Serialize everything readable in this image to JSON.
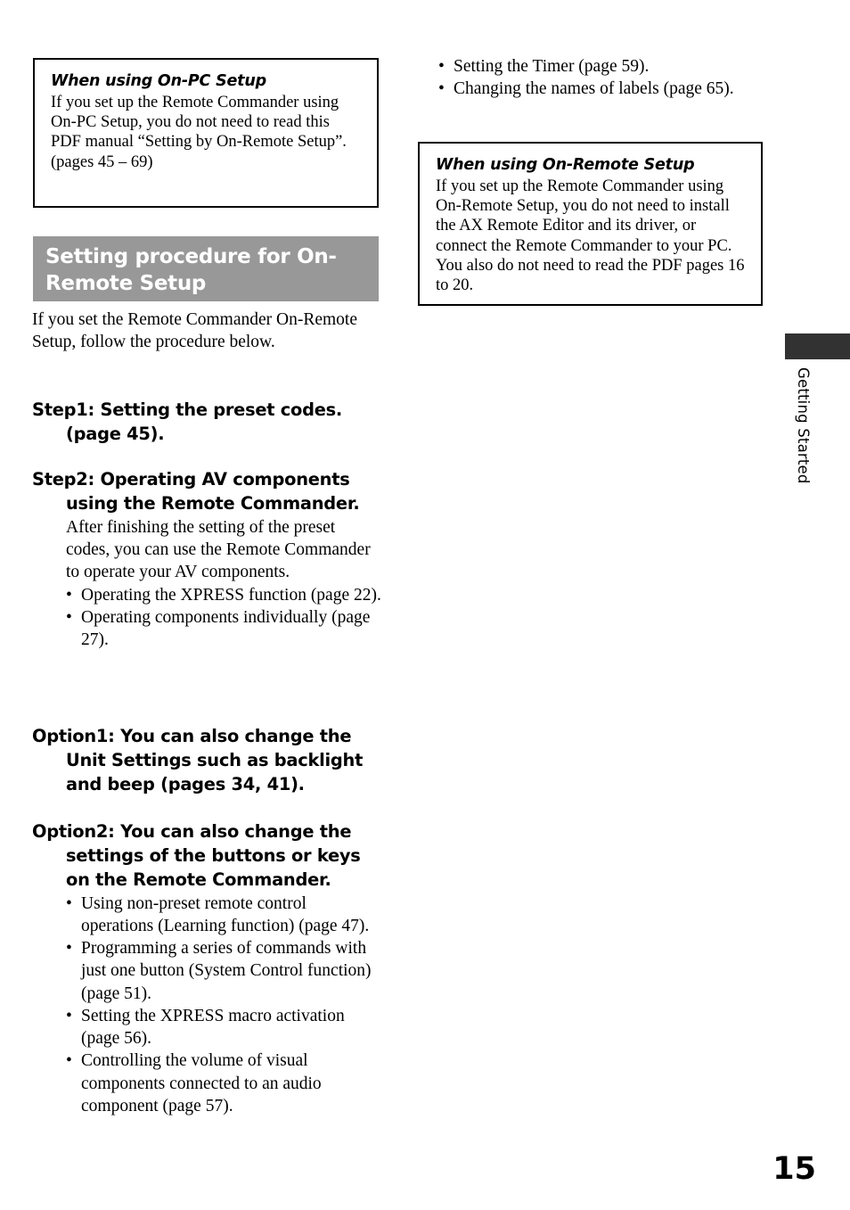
{
  "page": {
    "number": "15",
    "side_tab_label": "Getting Started",
    "side_tab_color": "#323232",
    "banner_color": "#989898"
  },
  "notes": {
    "on_pc": {
      "title": "When using On-PC Setup",
      "body": "If you set up the Remote Commander using On-PC Setup, you do not need to read this PDF manual “Setting by On-Remote Setup”.\n(pages 45 – 69)"
    },
    "on_remote": {
      "title": "When using On-Remote Setup",
      "body": "If you set up the Remote Commander using On-Remote Setup, you do not need to install the AX Remote Editor and its driver, or connect the Remote Commander to your PC. You also do not need to read the PDF pages 16 to 20."
    }
  },
  "section": {
    "banner_title": "Setting procedure for On-Remote Setup",
    "intro": "If you set the Remote Commander On-Remote Setup, follow the procedure below."
  },
  "blocks": {
    "step1": {
      "heading": "Step1: Setting the preset codes. (page 45)."
    },
    "step2": {
      "heading": "Step2: Operating AV components using the Remote Commander.",
      "body": "After finishing the setting of the preset codes, you can use the Remote Commander to operate your AV components.",
      "bullets": [
        "Operating the XPRESS function (page 22).",
        "Operating components individually (page 27)."
      ]
    },
    "option1": {
      "heading": "Option1: You can also change the Unit Settings such as backlight and beep (pages 34, 41)."
    },
    "option2": {
      "heading": "Option2: You can also change the settings of the buttons or keys on the Remote Commander.",
      "bullets": [
        "Using non-preset remote control operations (Learning function) (page 47).",
        "Programming a series of commands with just one button (System Control function) (page 51).",
        "Setting the XPRESS macro activation (page 56).",
        "Controlling the volume of visual components connected to an audio component (page 57)."
      ]
    }
  },
  "right_column": {
    "bullets": [
      "Setting the Timer (page 59).",
      "Changing the names of labels (page 65)."
    ]
  }
}
